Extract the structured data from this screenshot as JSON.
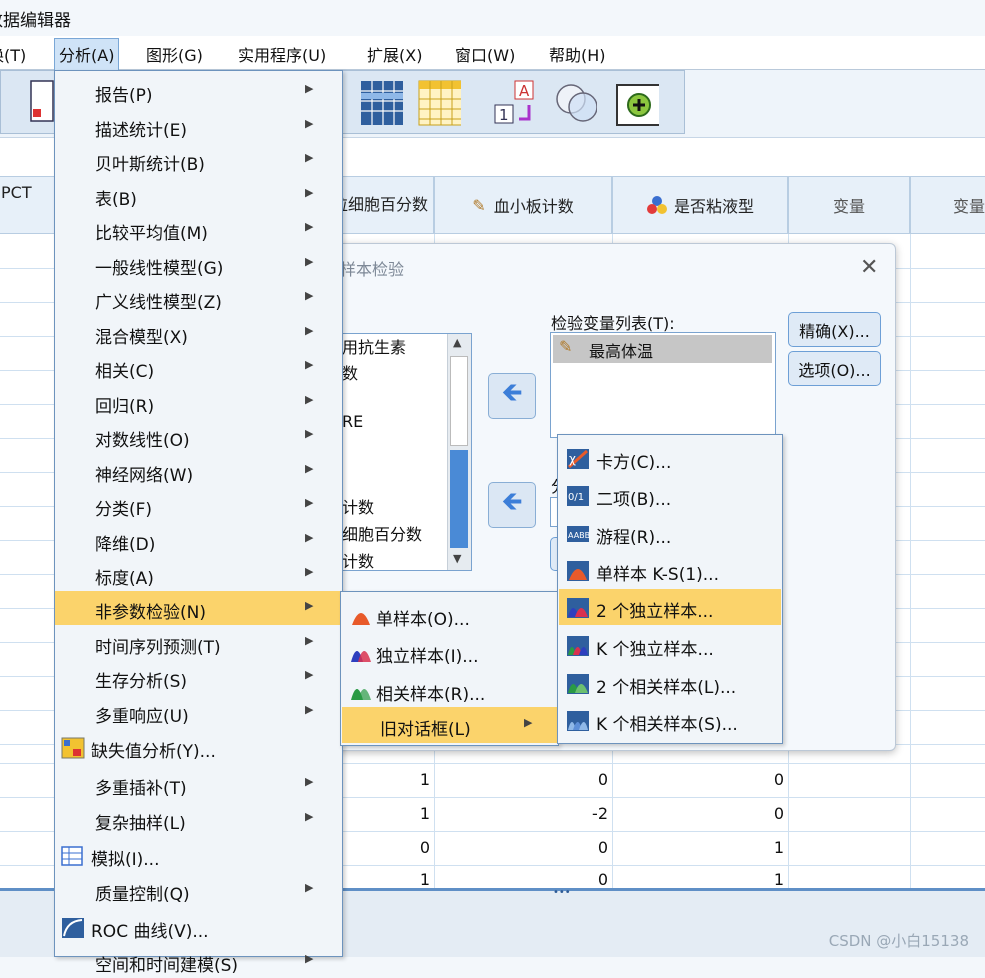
{
  "window": {
    "title": "数据编辑器"
  },
  "menubar": {
    "items": [
      {
        "label": "换(T)"
      },
      {
        "label": "分析(A)"
      },
      {
        "label": "图形(G)"
      },
      {
        "label": "实用程序(U)"
      },
      {
        "label": "扩展(X)"
      },
      {
        "label": "窗口(W)"
      },
      {
        "label": "帮助(H)"
      }
    ]
  },
  "sheet": {
    "headers": [
      "PCT",
      "粒细胞百分数",
      "血小板计数",
      "是否粘液型",
      "变量",
      "变量"
    ],
    "rows": [
      {
        "a": "1",
        "b": "0",
        "c": "0"
      },
      {
        "a": "1",
        "b": "-2",
        "c": "0"
      },
      {
        "a": "0",
        "b": "0",
        "c": "1"
      },
      {
        "a": "1",
        "b": "0",
        "c": "1"
      }
    ]
  },
  "dialog": {
    "title": "样本检验",
    "source_vars": [
      "用抗生素",
      "数",
      "",
      "RE",
      "",
      "",
      "计数",
      "细胞百分数",
      "计数"
    ],
    "test_list_label": "检验变量列表(T):",
    "test_vars": [
      "最高体温"
    ],
    "exact_button": "精确(X)...",
    "options_button": "选项(O)...",
    "hidden_label": "分"
  },
  "analyze_menu": {
    "items": [
      {
        "label": "报告(P)",
        "submenu": true
      },
      {
        "label": "描述统计(E)",
        "submenu": true
      },
      {
        "label": "贝叶斯统计(B)",
        "submenu": true
      },
      {
        "label": "表(B)",
        "submenu": true
      },
      {
        "label": "比较平均值(M)",
        "submenu": true
      },
      {
        "label": "一般线性模型(G)",
        "submenu": true
      },
      {
        "label": "广义线性模型(Z)",
        "submenu": true
      },
      {
        "label": "混合模型(X)",
        "submenu": true
      },
      {
        "label": "相关(C)",
        "submenu": true
      },
      {
        "label": "回归(R)",
        "submenu": true
      },
      {
        "label": "对数线性(O)",
        "submenu": true
      },
      {
        "label": "神经网络(W)",
        "submenu": true
      },
      {
        "label": "分类(F)",
        "submenu": true
      },
      {
        "label": "降维(D)",
        "submenu": true
      },
      {
        "label": "标度(A)",
        "submenu": true
      },
      {
        "label": "非参数检验(N)",
        "submenu": true,
        "highlighted": true
      },
      {
        "label": "时间序列预测(T)",
        "submenu": true
      },
      {
        "label": "生存分析(S)",
        "submenu": true
      },
      {
        "label": "多重响应(U)",
        "submenu": true
      },
      {
        "label": "缺失值分析(Y)...",
        "icon": "missing-values-icon"
      },
      {
        "label": "多重插补(T)",
        "submenu": true
      },
      {
        "label": "复杂抽样(L)",
        "submenu": true
      },
      {
        "label": "模拟(I)...",
        "icon": "simulation-icon"
      },
      {
        "label": "质量控制(Q)",
        "submenu": true
      },
      {
        "label": "ROC 曲线(V)...",
        "icon": "roc-curve-icon"
      },
      {
        "label": "空间和时间建模(S)",
        "submenu": true
      }
    ]
  },
  "nonparam_menu": {
    "items": [
      {
        "label": "单样本(O)...",
        "icon": "one-sample-icon"
      },
      {
        "label": "独立样本(I)...",
        "icon": "independent-samples-icon"
      },
      {
        "label": "相关样本(R)...",
        "icon": "related-samples-icon"
      },
      {
        "label": "旧对话框(L)",
        "submenu": true,
        "highlighted": true
      }
    ]
  },
  "legacy_menu": {
    "items": [
      {
        "label": "卡方(C)...",
        "icon": "chi-square-icon"
      },
      {
        "label": "二项(B)...",
        "icon": "binomial-icon"
      },
      {
        "label": "游程(R)...",
        "icon": "runs-icon"
      },
      {
        "label": "单样本 K-S(1)...",
        "icon": "one-sample-ks-icon"
      },
      {
        "label": "2 个独立样本...",
        "icon": "two-independent-icon",
        "highlighted": true
      },
      {
        "label": "K 个独立样本...",
        "icon": "k-independent-icon"
      },
      {
        "label": "2 个相关样本(L)...",
        "icon": "two-related-icon"
      },
      {
        "label": "K 个相关样本(S)...",
        "icon": "k-related-icon"
      }
    ]
  },
  "watermark": "CSDN @小白15138",
  "colors": {
    "highlight": "#fbd36b",
    "menu_bg": "#f1f5f9",
    "accent": "#3c7ed8"
  }
}
